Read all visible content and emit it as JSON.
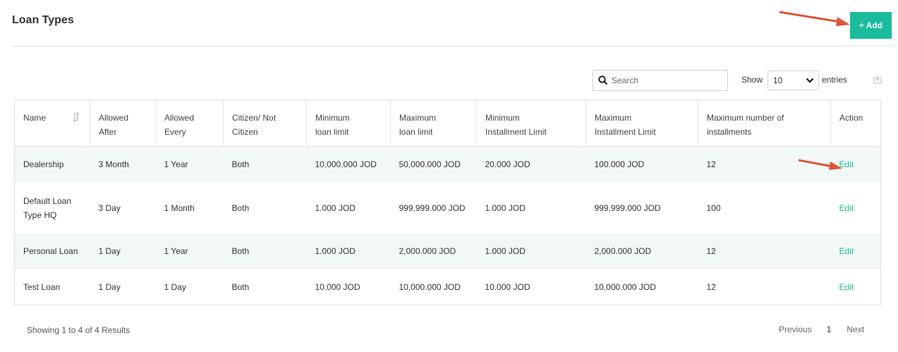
{
  "header": {
    "title": "Loan Types",
    "add_label": "+ Add"
  },
  "toolbar": {
    "search_placeholder": "Search",
    "show_label": "Show",
    "entries_value": "10",
    "entries_label": "entries"
  },
  "table": {
    "columns": [
      {
        "line1": "Name",
        "line2": ""
      },
      {
        "line1": "Allowed",
        "line2": "After"
      },
      {
        "line1": "Allowed",
        "line2": "Every"
      },
      {
        "line1": "Citizen/ Not",
        "line2": "Citizen"
      },
      {
        "line1": "Minimum",
        "line2": "loan limit"
      },
      {
        "line1": "Maximum",
        "line2": "loan limit"
      },
      {
        "line1": "Minimum",
        "line2": "Installment Limit"
      },
      {
        "line1": "Maximum",
        "line2": "Installment Limit"
      },
      {
        "line1": "Maximum number of",
        "line2": "installments"
      },
      {
        "line1": "Action",
        "line2": ""
      }
    ],
    "rows": [
      {
        "name_line1": "Dealership",
        "name_line2": "",
        "after": "3 Month",
        "every": "1 Year",
        "citizen": "Both",
        "min_loan": "10,000.000 JOD",
        "max_loan": "50,000.000 JOD",
        "min_inst": "20.000 JOD",
        "max_inst": "100.000 JOD",
        "max_count": "12",
        "action": "Edit"
      },
      {
        "name_line1": "Default Loan",
        "name_line2": "Type HQ",
        "after": "3 Day",
        "every": "1 Month",
        "citizen": "Both",
        "min_loan": "1.000 JOD",
        "max_loan": "999,999.000 JOD",
        "min_inst": "1.000 JOD",
        "max_inst": "999,999.000 JOD",
        "max_count": "100",
        "action": "Edit"
      },
      {
        "name_line1": "Personal Loan",
        "name_line2": "",
        "after": "1 Day",
        "every": "1 Year",
        "citizen": "Both",
        "min_loan": "1.000 JOD",
        "max_loan": "2,000.000 JOD",
        "min_inst": "1.000 JOD",
        "max_inst": "2,000.000 JOD",
        "max_count": "12",
        "action": "Edit"
      },
      {
        "name_line1": "Test Loan",
        "name_line2": "",
        "after": "1 Day",
        "every": "1 Day",
        "citizen": "Both",
        "min_loan": "10.000 JOD",
        "max_loan": "10,000.000 JOD",
        "min_inst": "10.000 JOD",
        "max_inst": "10,000.000 JOD",
        "max_count": "12",
        "action": "Edit"
      }
    ]
  },
  "footer": {
    "info": "Showing 1 to 4 of 4 Results",
    "prev_label": "Previous",
    "page": "1",
    "next_label": "Next"
  },
  "colors": {
    "accent": "#1abc9c",
    "arrow": "#e0533a",
    "stripe": "#f2f8f6"
  }
}
